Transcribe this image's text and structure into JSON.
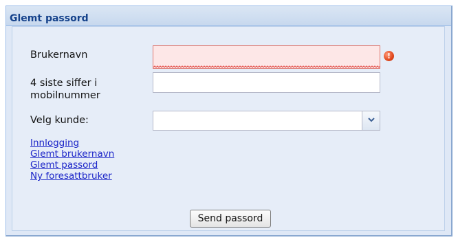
{
  "panel": {
    "title": "Glemt passord"
  },
  "form": {
    "username_label": "Brukernavn",
    "username_value": "",
    "username_error_icon": "exclamation-icon",
    "phone_label_line1": "4 siste siffer i",
    "phone_label_line2": "mobilnummer",
    "phone_value": "",
    "customer_label": "Velg kunde:",
    "customer_value": ""
  },
  "links": [
    "Innlogging",
    "Glemt brukernavn",
    "Glemt passord",
    "Ny foresattbruker"
  ],
  "button": {
    "label": "Send passord"
  },
  "colors": {
    "title": "#15428b",
    "link": "#1a24c8",
    "invalid_bg": "#fde7e7",
    "invalid_border": "#dd7870"
  }
}
